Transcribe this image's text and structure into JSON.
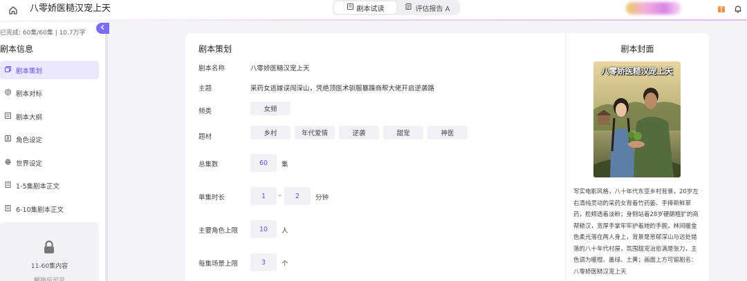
{
  "header": {
    "title": "八零娇医糙汉宠上天",
    "tabs": [
      {
        "label": "剧本试读",
        "icon": "book-icon",
        "active": true
      },
      {
        "label": "评估报告 A",
        "icon": "report-icon",
        "active": false
      }
    ]
  },
  "sidebar": {
    "progress": "已完成: 60集/60集 | 10.7万字",
    "section_title": "剧本信息",
    "items": [
      {
        "label": "剧本策划",
        "icon": "layers-icon",
        "active": true
      },
      {
        "label": "剧本对标",
        "icon": "target-icon",
        "active": false
      },
      {
        "label": "剧本大纲",
        "icon": "outline-icon",
        "active": false
      },
      {
        "label": "角色设定",
        "icon": "character-icon",
        "active": false
      },
      {
        "label": "世界设定",
        "icon": "globe-icon",
        "active": false
      },
      {
        "label": "1-5集剧本正文",
        "icon": "document-icon",
        "active": false
      },
      {
        "label": "6-10集剧本正文",
        "icon": "document-icon",
        "active": false
      }
    ],
    "locked": {
      "line1": "11-60集内容",
      "line2": "解锁后可见"
    }
  },
  "plan": {
    "title": "剧本策划",
    "name_label": "剧本名称",
    "name_value": "八零娇医糙汉宠上天",
    "theme_label": "主题",
    "theme_value": "采药女逃嫁误闯深山，凭绝顶医术驯服暴躁商帮大佬开启逆袭路",
    "channel_label": "频类",
    "channel_value": "女频",
    "genre_label": "题材",
    "genres": [
      "乡村",
      "年代爱情",
      "逆袭",
      "甜宠",
      "神医"
    ],
    "episodes_label": "总集数",
    "episodes_value": "60",
    "episodes_unit": "集",
    "duration_label": "单集时长",
    "duration_min": "1",
    "duration_sep": "-",
    "duration_max": "2",
    "duration_unit": "分钟",
    "roles_label": "主要角色上限",
    "roles_value": "10",
    "roles_unit": "人",
    "scenes_label": "每集场景上限",
    "scenes_value": "3",
    "scenes_unit": "个"
  },
  "cover": {
    "title": "剧本封面",
    "image_caption": "八零娇医糙汉宠上天",
    "description": "写实电影风格，八十年代东亚乡村背景，20岁左右清纯灵动的采药女背着竹药篓、手捧新鲜草药，脸颊透着淡粉；身侧站着28岁硬朗粗犷的商帮糙汉，宽厚手掌牢牢护着她的手腕，林间暖金色柔光落在两人身上，背景是葱郁深山与远处错落的八十年代村屋，氛围甜宠治愈满是张力，主色调为暖橙、墨绿、土黄；画面上方可留剧名：八零娇医糙汉宠上天"
  },
  "colors": {
    "accent": "#5b4de8",
    "accent_bg": "#ebe8fd",
    "collapse": "#7b6cf6"
  }
}
